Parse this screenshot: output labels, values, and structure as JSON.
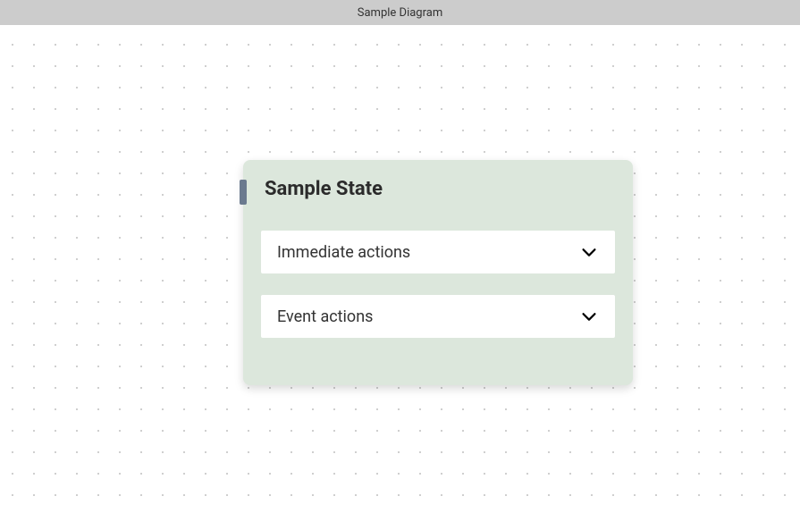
{
  "header": {
    "title": "Sample Diagram"
  },
  "state": {
    "title": "Sample State",
    "sections": [
      {
        "label": "Immediate actions"
      },
      {
        "label": "Event actions"
      }
    ]
  },
  "colors": {
    "header_bg": "#cccccc",
    "node_bg": "#dce7dc",
    "marker": "#6b7a8f"
  }
}
